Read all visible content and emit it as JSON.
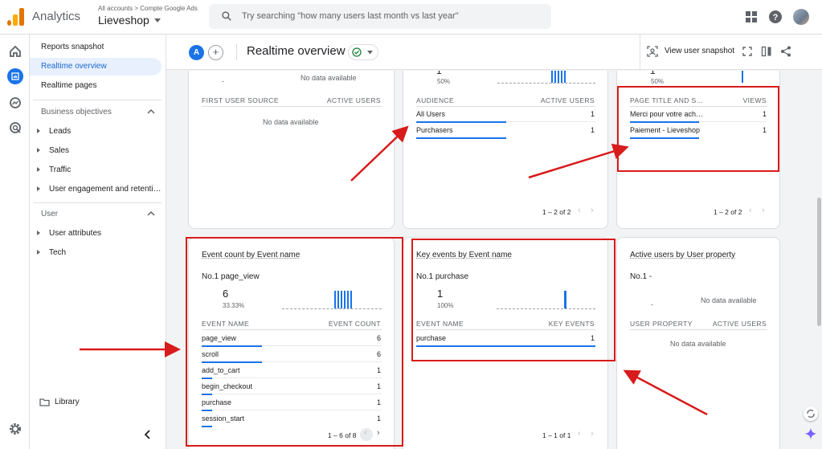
{
  "header": {
    "app_name": "Analytics",
    "account_path": "All accounts > Compte Google Ads",
    "property_name": "Lieveshop",
    "search_placeholder": "Try searching \"how many users last month vs last year\""
  },
  "sidenav": {
    "items": [
      {
        "label": "Reports snapshot"
      },
      {
        "label": "Realtime overview",
        "active": true
      },
      {
        "label": "Realtime pages"
      }
    ],
    "section_business": "Business objectives",
    "business_items": [
      "Leads",
      "Sales",
      "Traffic",
      "User engagement and retenti…"
    ],
    "section_user": "User",
    "user_items": [
      "User attributes",
      "Tech"
    ],
    "library": "Library"
  },
  "page_header": {
    "chip_letter": "A",
    "add_symbol": "+",
    "title": "Realtime overview",
    "snapshot_label": "View user snapshot"
  },
  "cards": {
    "first_user_source": {
      "top_dash": "-",
      "top_nodata": "No data available",
      "col1": "FIRST USER SOURCE",
      "col2": "ACTIVE USERS",
      "nodata": "No data available"
    },
    "audience": {
      "top_pct": "50%",
      "top_one": "1",
      "col1": "AUDIENCE",
      "col2": "ACTIVE USERS",
      "rows": [
        {
          "name": "All Users",
          "value": "1"
        },
        {
          "name": "Purchasers",
          "value": "1"
        }
      ],
      "pager": "1 – 2 of 2"
    },
    "page_title": {
      "top_pct": "50%",
      "top_one": "1",
      "col1": "PAGE TITLE AND S…",
      "col2": "VIEWS",
      "rows": [
        {
          "name": "Merci pour votre ach…",
          "value": "1"
        },
        {
          "name": "Paiement - Lieveshop",
          "value": "1"
        }
      ],
      "pager": "1 – 2 of 2"
    },
    "event_count": {
      "title": "Event count by Event name",
      "no1": "No.1  page_view",
      "big_value": "6",
      "pct": "33.33%",
      "col1": "EVENT NAME",
      "col2": "EVENT COUNT",
      "rows": [
        {
          "name": "page_view",
          "value": "6"
        },
        {
          "name": "scroll",
          "value": "6"
        },
        {
          "name": "add_to_cart",
          "value": "1"
        },
        {
          "name": "begin_checkout",
          "value": "1"
        },
        {
          "name": "purchase",
          "value": "1"
        },
        {
          "name": "session_start",
          "value": "1"
        }
      ],
      "pager": "1 – 6 of 8"
    },
    "key_events": {
      "title": "Key events by Event name",
      "no1": "No.1  purchase",
      "big_value": "1",
      "pct": "100%",
      "col1": "EVENT NAME",
      "col2": "KEY EVENTS",
      "rows": [
        {
          "name": "purchase",
          "value": "1"
        }
      ],
      "pager": "1 – 1 of 1"
    },
    "user_property": {
      "title": "Active users by User property",
      "no1": "No.1  -",
      "dash": "-",
      "nodata_top": "No data available",
      "col1": "USER PROPERTY",
      "col2": "ACTIVE USERS",
      "nodata": "No data available"
    }
  },
  "colors": {
    "accent": "#1a73e8",
    "annotation": "#d81b1b"
  }
}
